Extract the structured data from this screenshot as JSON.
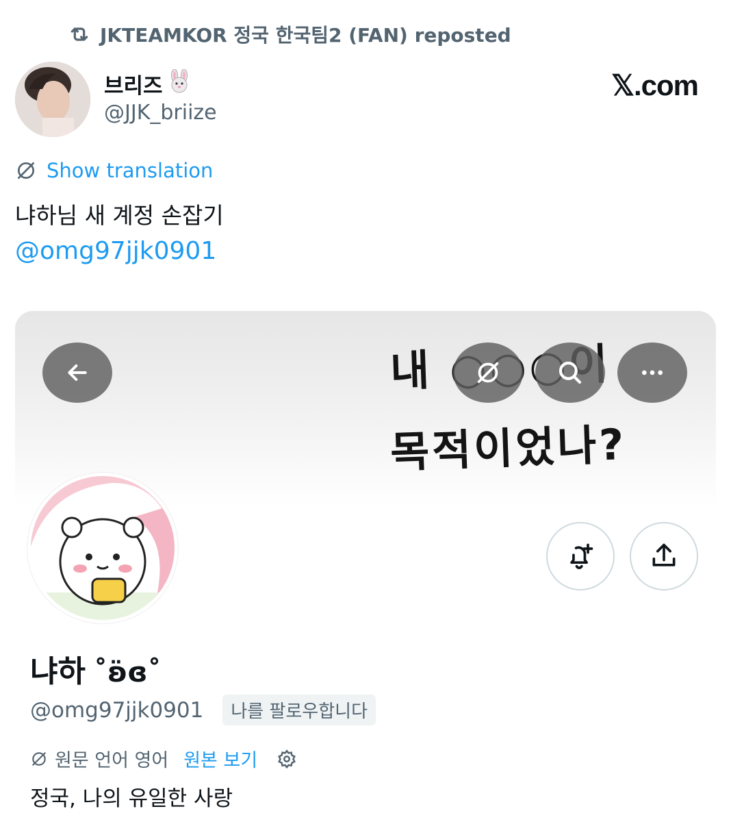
{
  "repost": {
    "icon": "repost-icon",
    "text": "JKTEAMKOR 정국 한국팀2 (FAN) reposted"
  },
  "author": {
    "name": "브리즈",
    "emoji": "🐰",
    "handle": "@JJK_briize",
    "avatar_icon": "portrait-avatar"
  },
  "brand": {
    "text": "𝕏.com"
  },
  "tweet": {
    "translation_icon": "globe-slash-icon",
    "translation_label": "Show translation",
    "text": "냐하님 새 계정 손잡기",
    "mention": "@omg97jjk0901"
  },
  "profile_card": {
    "banner_line1": "내 ○○○이",
    "banner_line2": "목적이었나?",
    "overlay_buttons": [
      "back-arrow-icon",
      "translate-icon",
      "search-icon",
      "more-icon"
    ],
    "display_name": "냐하",
    "name_emoticon": "˚ʚ̈ɞ˚",
    "handle": "@omg97jjk0901",
    "follows_you": "나를 팔로우합니다",
    "bio_lang_label": "원문 언어 영어",
    "bio_original_link": "원본 보기",
    "bio": "정국, 나의 유일한 사랑"
  },
  "colors": {
    "accent": "#1d9bf0",
    "secondary_text": "#536471",
    "text": "#0f1419"
  }
}
